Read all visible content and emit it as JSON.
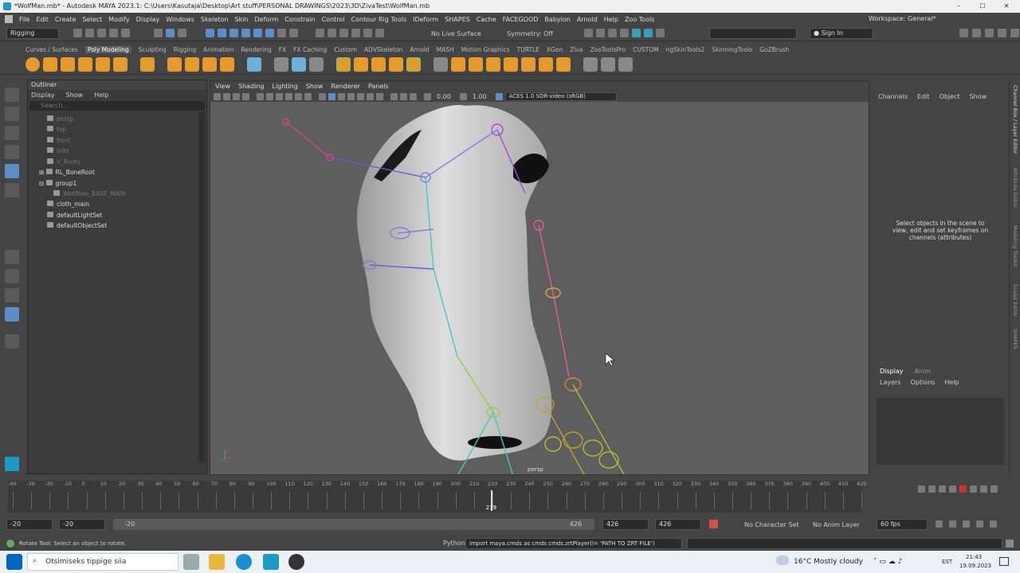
{
  "window": {
    "title": "*WolfMan.mb* - Autodesk MAYA 2023.1: C:\\Users\\Kasutaja\\Desktop\\Art stuff\\PERSONAL DRAWINGS\\2023\\3D\\ZivaTest\\WolfMan.mb"
  },
  "menu": [
    "File",
    "Edit",
    "Create",
    "Select",
    "Modify",
    "Display",
    "Windows",
    "Skeleton",
    "Skin",
    "Deform",
    "Constrain",
    "Control",
    "Contour Rig Tools",
    "IDeform",
    "SHAPES",
    "Cache",
    "FACEGOOD",
    "Babylon",
    "Arnold",
    "Help",
    "Zoo Tools"
  ],
  "workspace": {
    "label": "Workspace: General*"
  },
  "status_line": {
    "mode": "Rigging",
    "live_surface": "No Live Surface",
    "symmetry": "Symmetry: Off",
    "sign_in": "Sign In"
  },
  "shelf_tabs": [
    "Curves / Surfaces",
    "Poly Modeling",
    "Sculpting",
    "Rigging",
    "Animation",
    "Rendering",
    "FX",
    "FX Caching",
    "Custom",
    "ADVSkeleton",
    "Arnold",
    "MASH",
    "Motion Graphics",
    "TURTLE",
    "XGen",
    "Ziva",
    "ZooToolsPro",
    "CUSTOM",
    "ngSkinTools2",
    "SkinningTools",
    "GoZBrush"
  ],
  "shelf_active": "Poly Modeling",
  "outliner": {
    "title": "Outliner",
    "menu": [
      "Display",
      "Show",
      "Help"
    ],
    "search_placeholder": "Search...",
    "items": [
      {
        "label": "persp",
        "dim": true
      },
      {
        "label": "top",
        "dim": true
      },
      {
        "label": "front",
        "dim": true
      },
      {
        "label": "side",
        "dim": true
      },
      {
        "label": "V_Roots",
        "dim": true
      },
      {
        "label": "RL_BoneRoot",
        "dim": false
      },
      {
        "label": "group1",
        "dim": false
      },
      {
        "label": "WolfMan_BASE_MAIN",
        "dim": true
      },
      {
        "label": "cloth_main",
        "dim": false
      },
      {
        "label": "defaultLightSet",
        "dim": false
      },
      {
        "label": "defaultObjectSet",
        "dim": false
      }
    ]
  },
  "viewport": {
    "menu": [
      "View",
      "Shading",
      "Lighting",
      "Show",
      "Renderer",
      "Panels"
    ],
    "exposure": "0.00",
    "gamma": "1.00",
    "color_space": "ACES 1.0 SDR-video (sRGB)",
    "camera": "persp"
  },
  "channel_box": {
    "menu": [
      "Channels",
      "Edit",
      "Object",
      "Show"
    ],
    "hint": "Select objects in the scene to view, edit and set keyframes on channels (attributes)"
  },
  "side_tabs": [
    "Channel Box / Layer Editor",
    "Attribute Editor",
    "Modeling Toolkit",
    "Sculpt Editor",
    "SHAPES"
  ],
  "layer_editor": {
    "tabs": [
      "Display",
      "Anim"
    ],
    "menu": [
      "Layers",
      "Options",
      "Help"
    ]
  },
  "timeline": {
    "ticks": [
      "-40",
      "-30",
      "-20",
      "-10",
      "0",
      "10",
      "20",
      "30",
      "40",
      "50",
      "60",
      "70",
      "80",
      "90",
      "100",
      "110",
      "120",
      "130",
      "140",
      "150",
      "160",
      "170",
      "180",
      "190",
      "200",
      "210",
      "220",
      "230",
      "240",
      "250",
      "260",
      "270",
      "280",
      "290",
      "300",
      "310",
      "320",
      "330",
      "340",
      "350",
      "360",
      "370",
      "380",
      "390",
      "400",
      "410",
      "420"
    ],
    "current_frame": "219"
  },
  "range": {
    "start": "-20",
    "anim_start": "-20",
    "slider_start": "-20",
    "slider_end": "426",
    "end": "426",
    "anim_end": "426",
    "character_set": "No Character Set",
    "anim_layer": "No Anim Layer",
    "fps": "60 fps"
  },
  "command": {
    "help_line": "Rotate Tool: Select an object to rotate.",
    "language": "Python",
    "text": "import maya.cmds as cmds  cmds.zrtPlayer(l= 'PATH TO ZRT FILE')"
  },
  "taskbar": {
    "search": "Otsimiseks tippige siia",
    "weather": "16°C  Mostly cloudy",
    "lang": "EST",
    "time": "21:43",
    "date": "19.09.2023"
  }
}
